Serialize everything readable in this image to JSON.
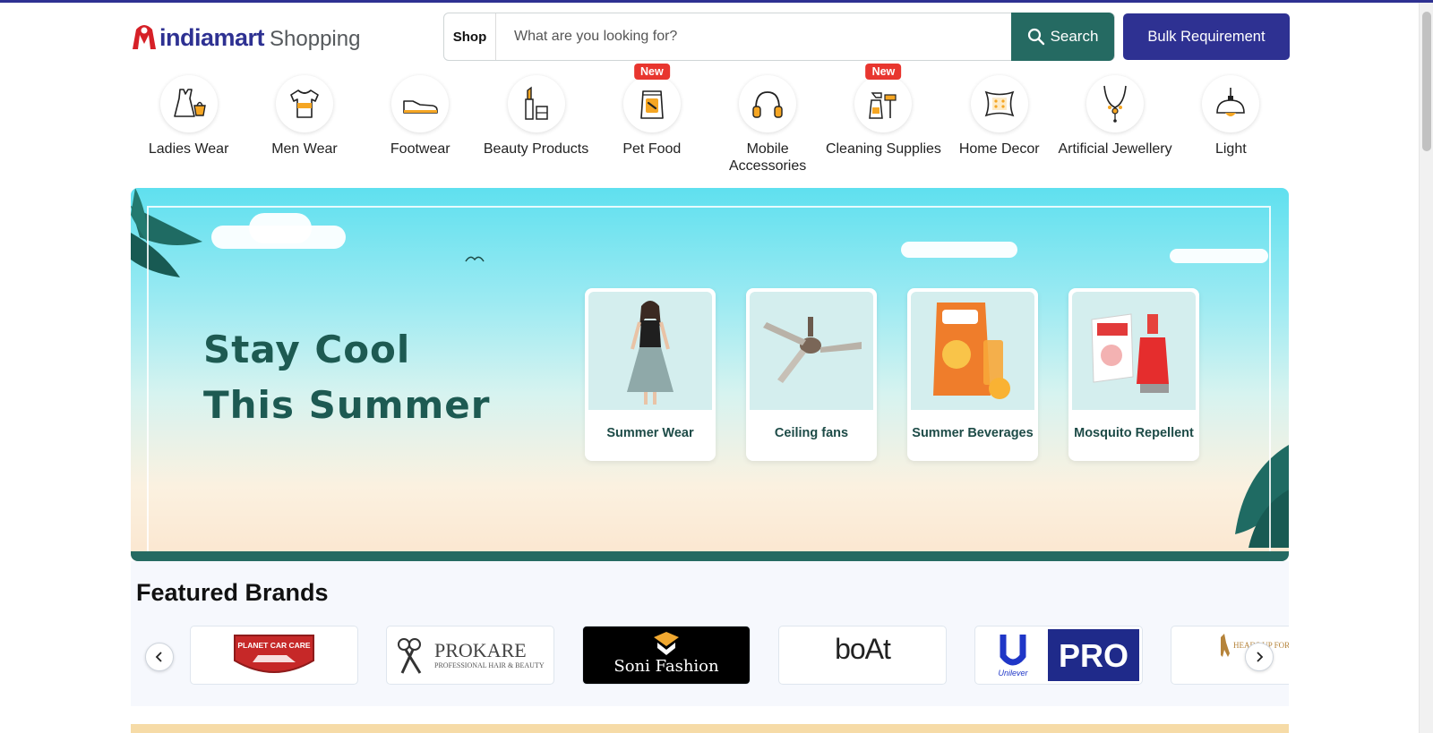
{
  "header": {
    "logo_text": "indiamart",
    "logo_suffix": "Shopping",
    "search": {
      "scope_label": "Shop",
      "placeholder": "What are you looking for?",
      "button_label": "Search"
    },
    "bulk_button_label": "Bulk Requirement"
  },
  "categories": [
    {
      "label": "Ladies Wear",
      "icon": "dress-icon",
      "badge": ""
    },
    {
      "label": "Men Wear",
      "icon": "tshirt-icon",
      "badge": ""
    },
    {
      "label": "Footwear",
      "icon": "shoe-icon",
      "badge": ""
    },
    {
      "label": "Beauty Products",
      "icon": "lipstick-icon",
      "badge": ""
    },
    {
      "label": "Pet Food",
      "icon": "pet-food-icon",
      "badge": "New"
    },
    {
      "label": "Mobile Accessories",
      "icon": "headphones-icon",
      "badge": ""
    },
    {
      "label": "Cleaning Supplies",
      "icon": "spray-bottle-icon",
      "badge": "New"
    },
    {
      "label": "Home Decor",
      "icon": "cushion-icon",
      "badge": ""
    },
    {
      "label": "Artificial Jewellery",
      "icon": "necklace-icon",
      "badge": ""
    },
    {
      "label": "Light",
      "icon": "pendant-lamp-icon",
      "badge": ""
    }
  ],
  "banner": {
    "title_line1": "Stay Cool",
    "title_line2": "This Summer",
    "cards": [
      {
        "label": "Summer Wear",
        "image": "dress-model-image"
      },
      {
        "label": "Ceiling fans",
        "image": "ceiling-fan-image"
      },
      {
        "label": "Summer Beverages",
        "image": "beverage-pack-image"
      },
      {
        "label": "Mosquito Repellent",
        "image": "mosquito-repellent-image"
      }
    ]
  },
  "featured_brands": {
    "title": "Featured Brands",
    "brands": [
      {
        "name": "PLANET CAR CARE",
        "logo": "planet-car-care-logo"
      },
      {
        "name": "PROKARE",
        "tagline": "PROFESSIONAL HAIR & BEAUTY",
        "logo": "prokare-logo"
      },
      {
        "name": "Soni Fashion",
        "logo": "soni-fashion-logo"
      },
      {
        "name": "boAt",
        "logo": "boat-logo"
      },
      {
        "name": "PRO",
        "sub": "Unilever",
        "logo": "unilever-pro-logo"
      },
      {
        "name": "HEADS UP FOR TAILS",
        "logo": "heads-up-for-tails-logo"
      }
    ]
  },
  "colors": {
    "brand_navy": "#2e3192",
    "brand_green": "#256a62",
    "badge_red": "#e8362f",
    "icon_amber": "#f5a623"
  }
}
